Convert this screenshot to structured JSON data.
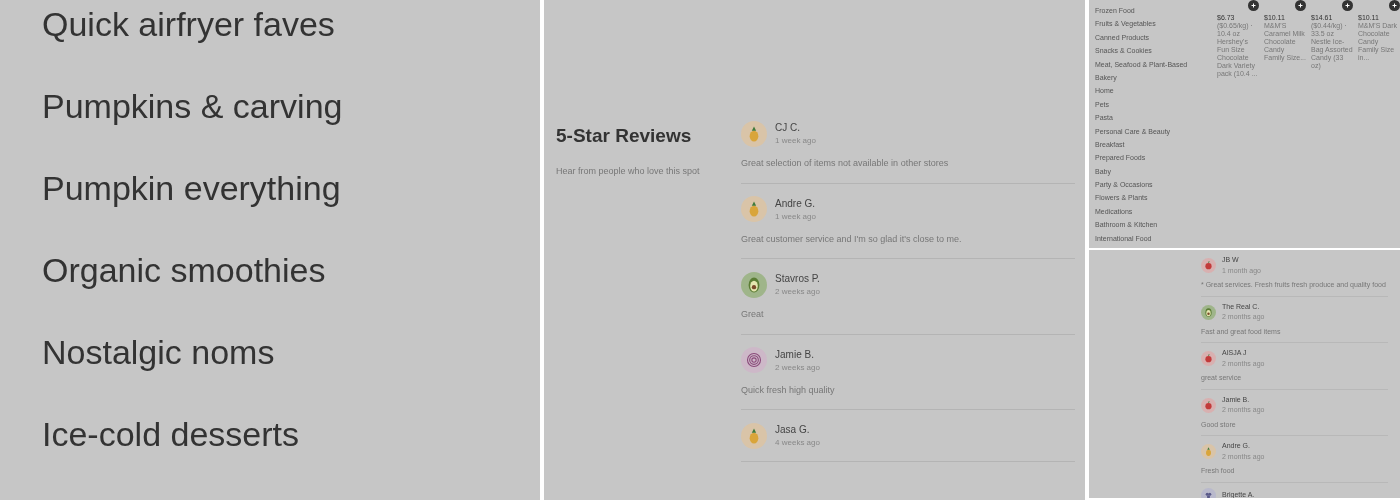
{
  "collections": {
    "items": [
      "Quick airfryer faves",
      "Pumpkins & carving",
      "Pumpkin everything",
      "Organic smoothies",
      "Nostalgic noms",
      "Ice-cold desserts"
    ]
  },
  "reviews_section": {
    "title": "5-Star Reviews",
    "subtitle": "Hear from people who love this spot",
    "reviews": [
      {
        "name": "CJ C.",
        "time": "1 week ago",
        "text": "Great selection of items not available in other stores",
        "kind": "pineapple"
      },
      {
        "name": "Andre G.",
        "time": "1 week ago",
        "text": "Great customer service and I'm so glad it's close to me.",
        "kind": "pineapple"
      },
      {
        "name": "Stavros P.",
        "time": "2 weeks ago",
        "text": "Great",
        "kind": "avocado"
      },
      {
        "name": "Jamie B.",
        "time": "2 weeks ago",
        "text": "Quick fresh high quality",
        "kind": "onion"
      },
      {
        "name": "Jasa G.",
        "time": "4 weeks ago",
        "kind": "pineapple"
      }
    ]
  },
  "store": {
    "categories": [
      "Frozen Food",
      "Fruits & Vegetables",
      "Canned Products",
      "Snacks & Cookies",
      "Meat, Seafood & Plant-Based",
      "Bakery",
      "Home",
      "Pets",
      "Pasta",
      "Personal Care & Beauty",
      "Breakfast",
      "Prepared Foods",
      "Baby",
      "Party & Occasions",
      "Flowers & Plants",
      "Medications",
      "Bathroom & Kitchen",
      "International Food"
    ],
    "products": [
      {
        "price": "$6.73",
        "unit": "($0.65/kg) · 10.4 oz",
        "name": "Hershey's Fun Size Chocolate Dark Variety pack (10.4 ..."
      },
      {
        "price": "$10.11",
        "name": "M&M'S Caramel Milk Chocolate Candy Family Size..."
      },
      {
        "price": "$14.61",
        "unit": "($0.44/kg) · 33.5 oz",
        "name": "Nestle Ice-Bag Assorted Candy (33 oz)"
      },
      {
        "price": "$10.11",
        "name": "M&M'S Dark Chocolate Candy Family Size in..."
      }
    ]
  },
  "more_reviews": [
    {
      "name": "JB W",
      "time": "1 month ago",
      "text": "* Great services. Fresh fruits fresh produce and quality food",
      "kind": "apple"
    },
    {
      "name": "The Real C.",
      "time": "2 months ago",
      "text": "Fast and great food items",
      "kind": "avocado"
    },
    {
      "name": "AISJA J",
      "time": "2 months ago",
      "text": "great service",
      "kind": "apple"
    },
    {
      "name": "Jamie B.",
      "time": "2 months ago",
      "text": "Good store",
      "kind": "apple"
    },
    {
      "name": "Andre G.",
      "time": "2 months ago",
      "text": "Fresh food",
      "kind": "pineapple"
    },
    {
      "name": "Brigette A.",
      "kind": "grapes"
    }
  ]
}
